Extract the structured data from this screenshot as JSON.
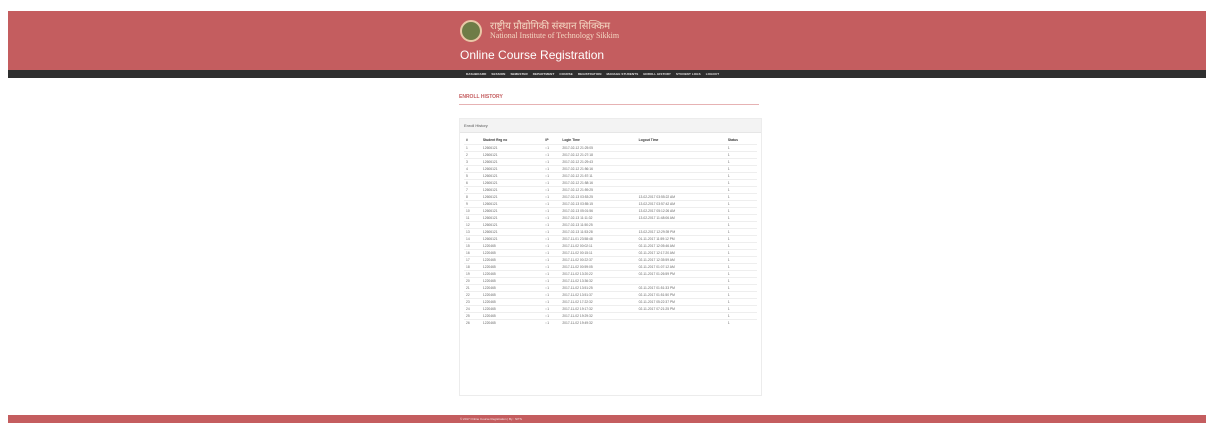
{
  "header": {
    "inst_name_hi": "राष्ट्रीय प्रौद्योगिकी संस्थान सिक्किम",
    "inst_name_en": "National Institute of Technology Sikkim",
    "app_title": "Online Course Registration"
  },
  "nav": [
    "DASHBOARD",
    "SESSION",
    "SEMESTER",
    "DEPARTMENT",
    "COURSE",
    "REGISTRATION",
    "MANAGE STUDENTS",
    "ENROLL HISTORY",
    "STUDENT LOGS",
    "LOGOUT"
  ],
  "page_title": "ENROLL HISTORY",
  "panel_title": "Enroll History",
  "columns": [
    "#",
    "Student Reg no",
    "IP",
    "Login Time",
    "Logout Time",
    "Status"
  ],
  "rows": [
    [
      "1",
      "12606121",
      "::1",
      "2017-02-12 21:25:05",
      "",
      "1"
    ],
    [
      "2",
      "12606121",
      "::1",
      "2017-02-12 21:27:18",
      "",
      "1"
    ],
    [
      "3",
      "12606121",
      "::1",
      "2017-02-12 21:29:43",
      "",
      "1"
    ],
    [
      "4",
      "12606121",
      "::1",
      "2017-02-12 21:56:16",
      "",
      "1"
    ],
    [
      "5",
      "12606121",
      "::1",
      "2017-02-12 21:57:11",
      "",
      "1"
    ],
    [
      "6",
      "12606121",
      "::1",
      "2017-02-12 21:58:16",
      "",
      "1"
    ],
    [
      "7",
      "12606121",
      "::1",
      "2017-02-12 21:59:25",
      "",
      "1"
    ],
    [
      "8",
      "12606121",
      "::1",
      "2017-02-13 03:53:25",
      "13-02-2017 03:55:22 AM",
      "1"
    ],
    [
      "9",
      "12606121",
      "::1",
      "2017-02-13 03:55:15",
      "13-02-2017 03:57:42 AM",
      "1"
    ],
    [
      "10",
      "12606121",
      "::1",
      "2017-02-13 05:01:56",
      "13-02-2017 05:12:26 AM",
      "1"
    ],
    [
      "11",
      "12606121",
      "::1",
      "2017-02-13 11:11:32",
      "13-02-2017 11:48:06 AM",
      "1"
    ],
    [
      "12",
      "12606121",
      "::1",
      "2017-02-13 11:50:25",
      "",
      "1"
    ],
    [
      "13",
      "12606121",
      "::1",
      "2017-02-13 11:53:28",
      "13-02-2017 12:29:39 PM",
      "1"
    ],
    [
      "14",
      "12606121",
      "::1",
      "2017-11-01 23:58:48",
      "01-11-2017 11:59:12 PM",
      "1"
    ],
    [
      "15",
      "1220465",
      "::1",
      "2017-11-02 00:02:11",
      "02-11-2017 12:05:46 AM",
      "1"
    ],
    [
      "16",
      "1220465",
      "::1",
      "2017-11-02 00:15:11",
      "02-11-2017 12:17:20 AM",
      "1"
    ],
    [
      "17",
      "1220465",
      "::1",
      "2017-11-02 00:22:37",
      "02-11-2017 12:35:59 AM",
      "1"
    ],
    [
      "18",
      "1220465",
      "::1",
      "2017-11-02 00:59:05",
      "02-11-2017 01:07:12 AM",
      "1"
    ],
    [
      "19",
      "1220465",
      "::1",
      "2017-11-02 13:20:22",
      "02-11-2017 01:26:59 PM",
      "1"
    ],
    [
      "20",
      "1220465",
      "::1",
      "2017-11-02 13:36:32",
      "",
      "1"
    ],
    [
      "21",
      "1220465",
      "::1",
      "2017-11-02 13:51:25",
      "02-11-2017 01:51:33 PM",
      "1"
    ],
    [
      "22",
      "1220465",
      "::1",
      "2017-11-02 13:51:37",
      "02-11-2017 01:51:50 PM",
      "1"
    ],
    [
      "23",
      "1220465",
      "::1",
      "2017-11-02 17:22:32",
      "02-11-2017 05:22:37 PM",
      "1"
    ],
    [
      "24",
      "1220465",
      "::1",
      "2017-11-02 19:17:32",
      "02-11-2017 07:21:25 PM",
      "1"
    ],
    [
      "25",
      "1220465",
      "::1",
      "2017-11-02 19:29:32",
      "",
      "1"
    ],
    [
      "26",
      "1220465",
      "::1",
      "2017-11-02 19:49:32",
      "",
      "1"
    ]
  ],
  "footer_text": "© 2017 Online Course Registration | By : NITS"
}
